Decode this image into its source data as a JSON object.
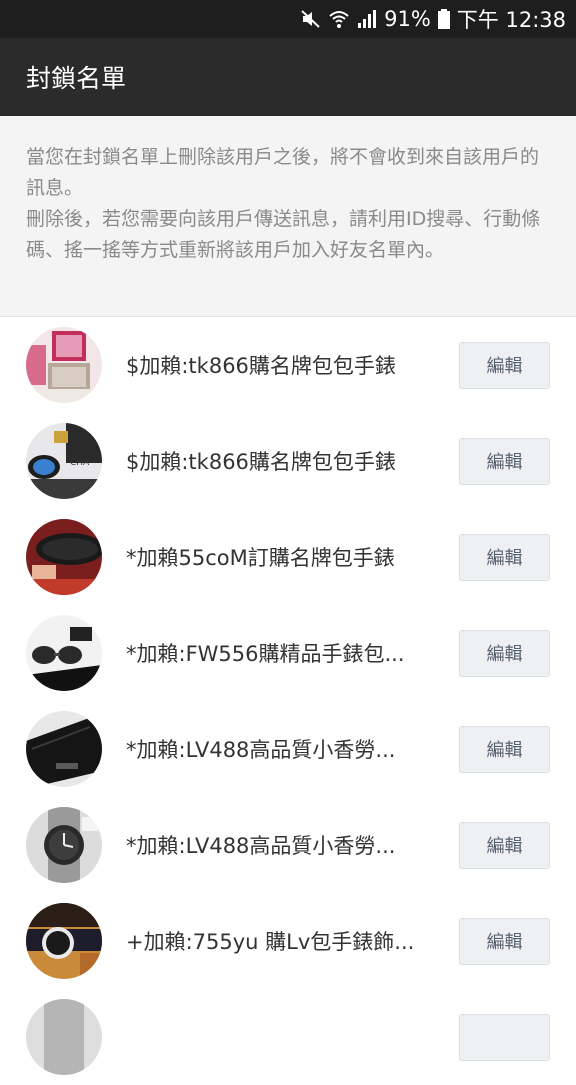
{
  "status_bar": {
    "battery": "91%",
    "time": "下午 12:38",
    "icons": [
      "mute-icon",
      "wifi-icon",
      "signal-icon",
      "battery-icon"
    ]
  },
  "header": {
    "title": "封鎖名單"
  },
  "notice": {
    "line1": "當您在封鎖名單上刪除該用戶之後，將不會收到來自該用戶的訊息。",
    "line2": "刪除後，若您需要向該用戶傳送訊息，請利用ID搜尋、行動條碼、搖一搖等方式重新將該用戶加入好友名單內。"
  },
  "blocked_list": {
    "edit_label": "編輯",
    "items": [
      {
        "name": "$加賴:tk866購名牌包包手錶"
      },
      {
        "name": "$加賴:tk866購名牌包包手錶"
      },
      {
        "name": "*加賴55coM訂購名牌包手錶"
      },
      {
        "name": "*加賴:FW556購精品手錶包..."
      },
      {
        "name": "*加賴:LV488高品質小香勞..."
      },
      {
        "name": "*加賴:LV488高品質小香勞..."
      },
      {
        "name": "+加賴:755yu 購Lv包手錶飾..."
      }
    ]
  },
  "colors": {
    "status_bar_bg": "#1e1e1e",
    "app_bar_bg": "#2b2b2b",
    "notice_bg": "#f4f4f4",
    "edit_button_bg": "#eef0f4"
  }
}
